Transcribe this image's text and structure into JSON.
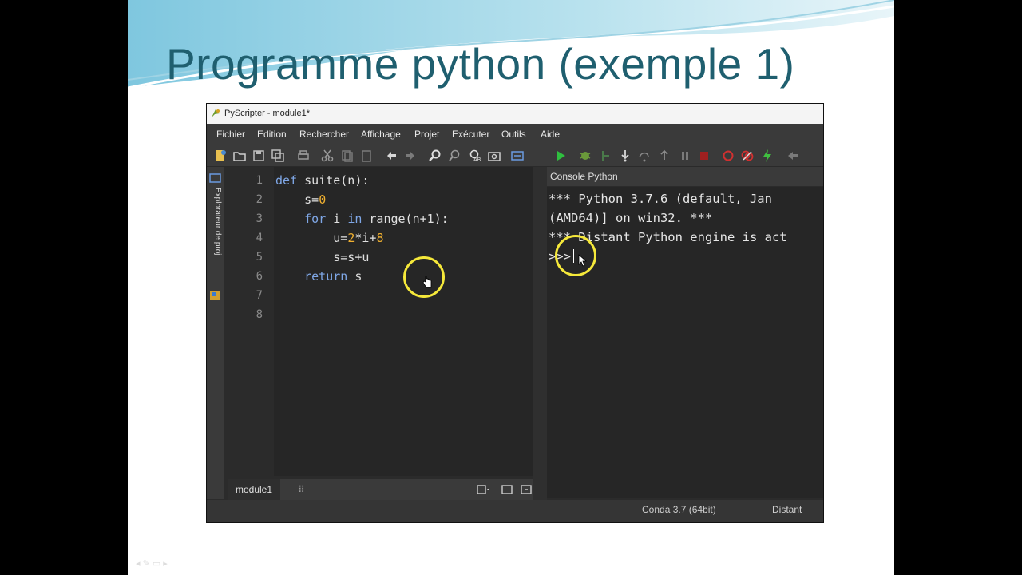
{
  "slide": {
    "title": "Programme python (exemple 1)"
  },
  "app": {
    "window_title": "PyScripter - module1*",
    "menu": [
      "Fichier",
      "Edition",
      "Rechercher",
      "Affichage",
      "Projet",
      "Exécuter",
      "Outils",
      "Aide"
    ],
    "side_panel_label": "Explorateur de proj"
  },
  "editor": {
    "line_numbers": [
      "1",
      "2",
      "3",
      "4",
      "5",
      "6",
      "7",
      "8"
    ],
    "code": {
      "l1_kw": "def",
      "l1_rest": " suite(n):",
      "l2_a": "s=",
      "l2_num": "0",
      "l3_kw_for": "for",
      "l3_i": " i ",
      "l3_kw_in": "in",
      "l3_rest": " range(n+1):",
      "l4_a": "u=",
      "l4_n1": "2",
      "l4_b": "*i+",
      "l4_n2": "8",
      "l5": "s=s+u",
      "l6_kw": "return",
      "l6_rest": " s"
    },
    "tab_label": "module1",
    "tab_close": "⠿"
  },
  "console": {
    "header": "Console Python",
    "lines": [
      "*** Python 3.7.6 (default, Jan",
      "(AMD64)] on win32. ***",
      "*** Distant Python engine is act"
    ],
    "prompt": ">>>"
  },
  "status": {
    "interpreter": "Conda 3.7 (64bit)",
    "engine": "Distant"
  },
  "colors": {
    "accent_highlight": "#f5e83a",
    "keyword": "#7fa7e6",
    "number": "#f0b030"
  }
}
